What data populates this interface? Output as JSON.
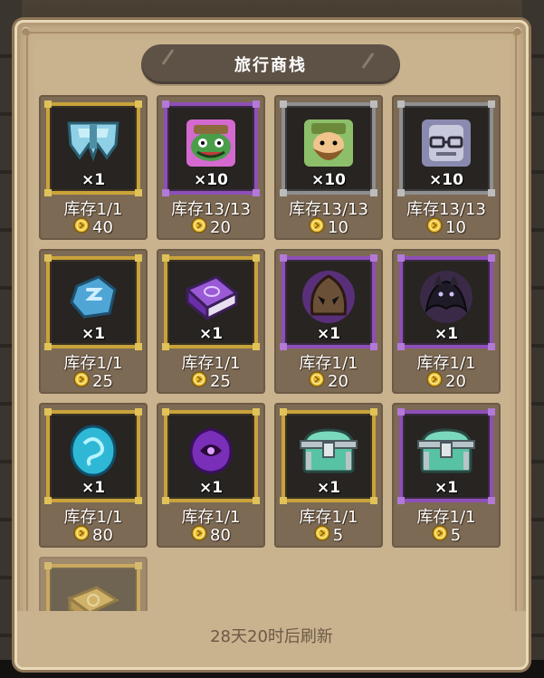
{
  "shop": {
    "title": "旅行商栈",
    "refresh_text": "28天20时后刷新"
  },
  "colors": {
    "panel": "#c9b28e",
    "card": "#7d6a54",
    "rarity_gold": "#c9a33a",
    "rarity_purple": "#8e4fb8",
    "rarity_gray": "#8f8f8f"
  },
  "items": [
    {
      "icon": "helmet-icon",
      "rarity": "gold",
      "qty": "×1",
      "stock": "库存1/1",
      "price": "40"
    },
    {
      "icon": "green-monster-portrait-icon",
      "rarity": "purple",
      "qty": "×10",
      "stock": "库存13/13",
      "price": "20"
    },
    {
      "icon": "bearded-hero-portrait-icon",
      "rarity": "gray",
      "qty": "×10",
      "stock": "库存13/13",
      "price": "10"
    },
    {
      "icon": "robot-glasses-portrait-icon",
      "rarity": "gray",
      "qty": "×10",
      "stock": "库存13/13",
      "price": "10"
    },
    {
      "icon": "blue-rune-stone-icon",
      "rarity": "gold",
      "qty": "×1",
      "stock": "库存1/1",
      "price": "25"
    },
    {
      "icon": "purple-spellbook-icon",
      "rarity": "gold",
      "qty": "×1",
      "stock": "库存1/1",
      "price": "25"
    },
    {
      "icon": "hooded-mask-icon",
      "rarity": "purple",
      "qty": "×1",
      "stock": "库存1/1",
      "price": "20"
    },
    {
      "icon": "dark-dragon-icon",
      "rarity": "purple",
      "qty": "×1",
      "stock": "库存1/1",
      "price": "20"
    },
    {
      "icon": "cyan-swirl-coin-icon",
      "rarity": "gold",
      "qty": "×1",
      "stock": "库存1/1",
      "price": "80"
    },
    {
      "icon": "purple-vortex-icon",
      "rarity": "gold",
      "qty": "×1",
      "stock": "库存1/1",
      "price": "80"
    },
    {
      "icon": "teal-chest-icon",
      "rarity": "gold",
      "qty": "×1",
      "stock": "库存1/1",
      "price": "5"
    },
    {
      "icon": "teal-chest-icon",
      "rarity": "purple",
      "qty": "×1",
      "stock": "库存1/1",
      "price": "5"
    },
    {
      "icon": "golden-book-icon",
      "rarity": "gold",
      "qty": "",
      "stock": "",
      "price": ""
    }
  ]
}
